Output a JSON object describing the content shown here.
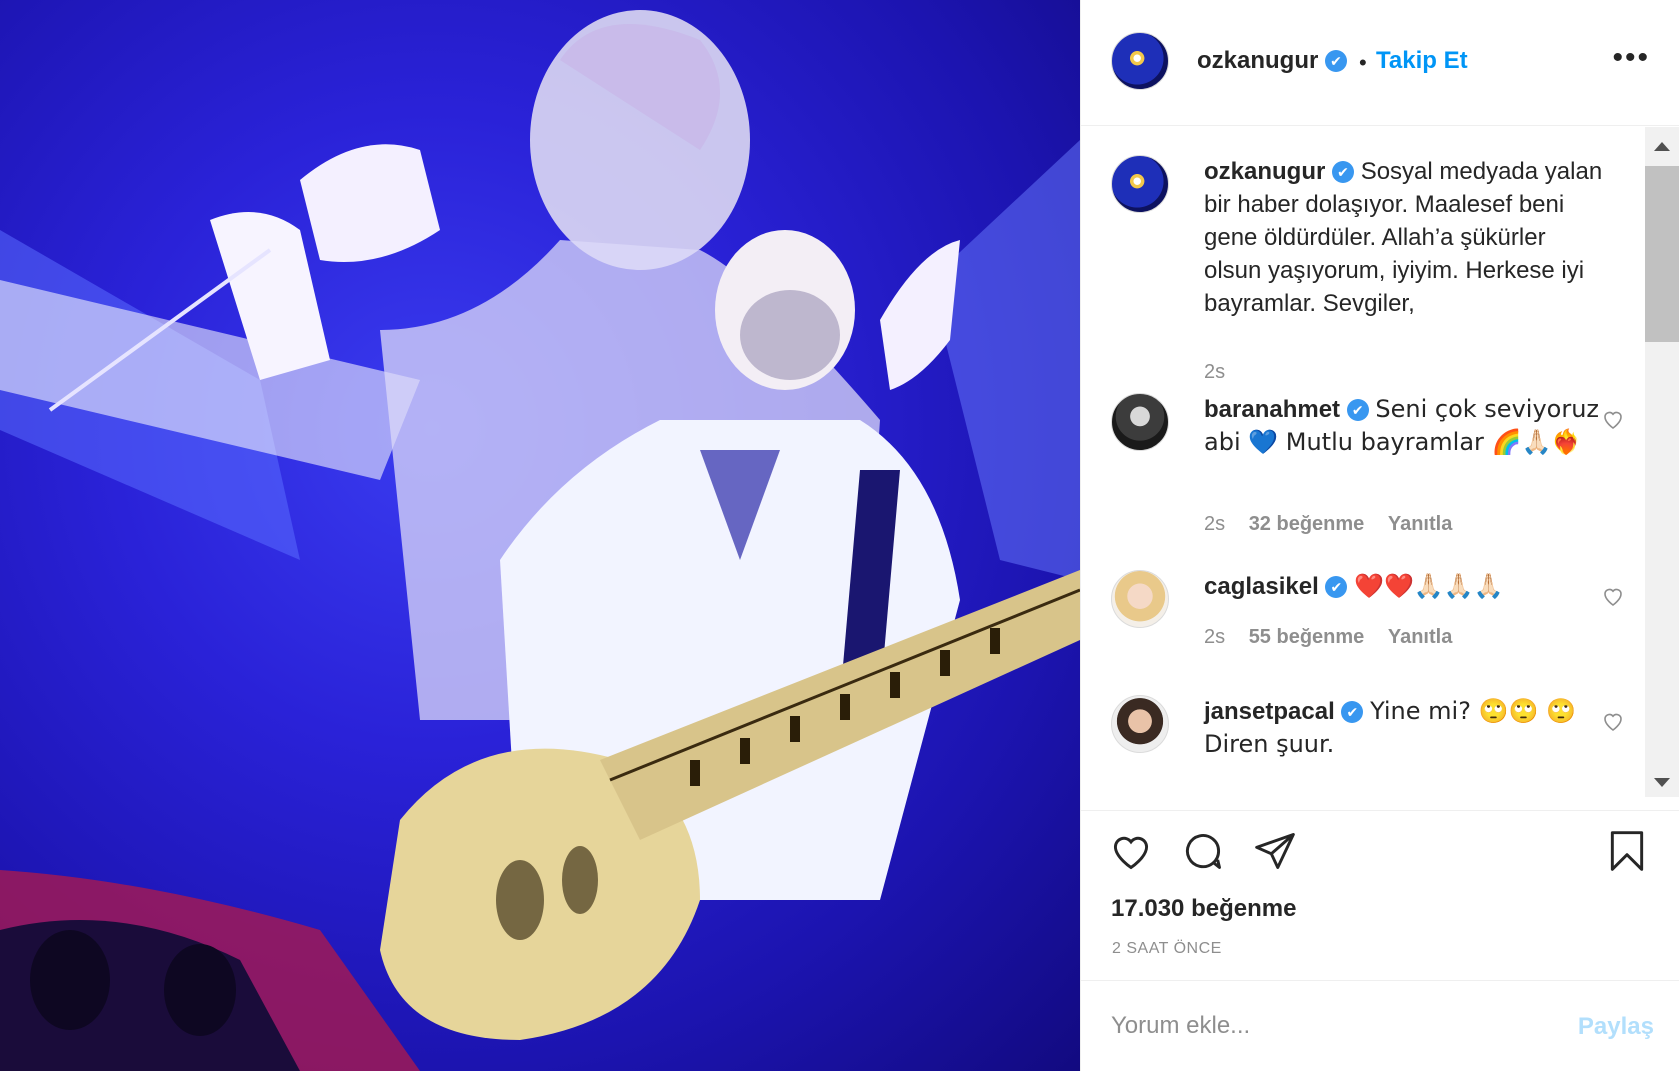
{
  "post": {
    "image_alt": "Concert photo: singer holding a microphone and guitarist with a bass guitar, tinted blue",
    "author": {
      "username": "ozkanugur",
      "verified_mark": "✔",
      "follow_label": "Takip Et",
      "separator": "•"
    },
    "more_icon": "•••",
    "caption": {
      "text": "Sosyal medyada yalan bir haber dolaşıyor. Maalesef beni gene öldürdüler. Allah’a şükürler olsun yaşıyorum, iyiyim. Herkese iyi bayramlar. Sevgiler,",
      "time": "2s"
    },
    "comments": [
      {
        "username": "baranahmet",
        "text": "Seni çok seviyoruz abi 💙 Mutlu bayramlar 🌈🙏🏻❤️‍🔥",
        "time": "2s",
        "likes": "32 beğenme",
        "reply": "Yanıtla"
      },
      {
        "username": "caglasikel",
        "text": "❤️❤️🙏🏻🙏🏻🙏🏻",
        "time": "2s",
        "likes": "55 beğenme",
        "reply": "Yanıtla"
      },
      {
        "username": "jansetpacal",
        "text": "Yine mi? 🙄🙄 🙄 Diren şuur.",
        "time": "",
        "likes": "",
        "reply": ""
      }
    ],
    "likes_count": "17.030 beğenme",
    "posted_ago": "2 SAAT ÖNCE",
    "comment_input": {
      "placeholder": "Yorum ekle..."
    },
    "share_label": "Paylaş"
  },
  "colors": {
    "accent": "#0095f6",
    "verified": "#3897f0",
    "muted": "#8e8e8e",
    "share_disabled": "#b2dffc"
  }
}
